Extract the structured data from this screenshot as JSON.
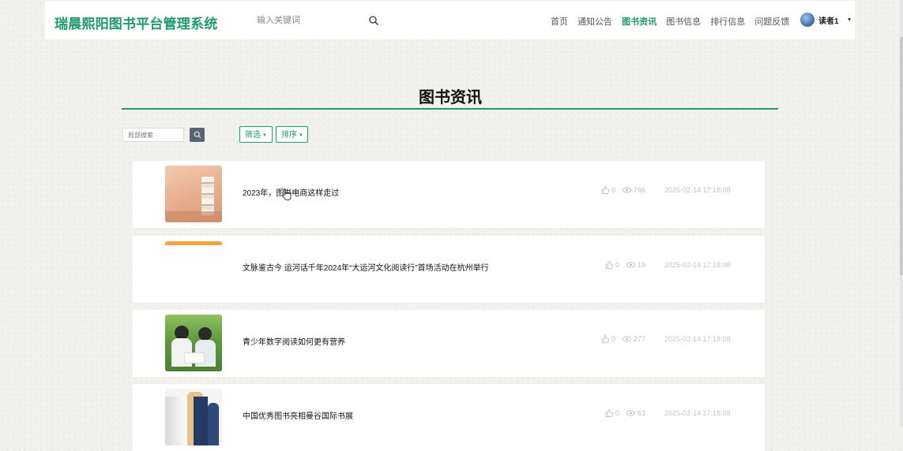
{
  "header": {
    "brand": "瑞晨熙阳图书平台管理系统",
    "search_placeholder": "输入关键词",
    "nav": [
      "首页",
      "通知公告",
      "图书资讯",
      "图书信息",
      "排行信息",
      "问题反馈"
    ],
    "active_nav": "图书资讯",
    "user_name": "读者1",
    "accent_color": "#1f9a6e"
  },
  "page": {
    "title": "图书资讯",
    "local_search_placeholder": "局部搜索",
    "filter_label": "筛选",
    "sort_label": "排序"
  },
  "news": [
    {
      "title": "2023年，图书电商这样走过",
      "likes": "0",
      "views": "766",
      "date": "2025-02-14 17:18:08",
      "thumb": "books-on-table"
    },
    {
      "title": "文脉鉴古今 运河话千年2024年“大运河文化阅读行”首场活动在杭州举行",
      "likes": "0",
      "views": "19",
      "date": "2025-02-14 17:18:08",
      "thumb": "orange-banner"
    },
    {
      "title": "青少年数字阅读如何更有营养",
      "likes": "0",
      "views": "277",
      "date": "2025-02-14 17:18:08",
      "thumb": "children-reading"
    },
    {
      "title": "中国优秀图书亮相曼谷国际书展",
      "likes": "0",
      "views": "63",
      "date": "2025-02-14 17:18:08",
      "thumb": "book-covers"
    }
  ]
}
